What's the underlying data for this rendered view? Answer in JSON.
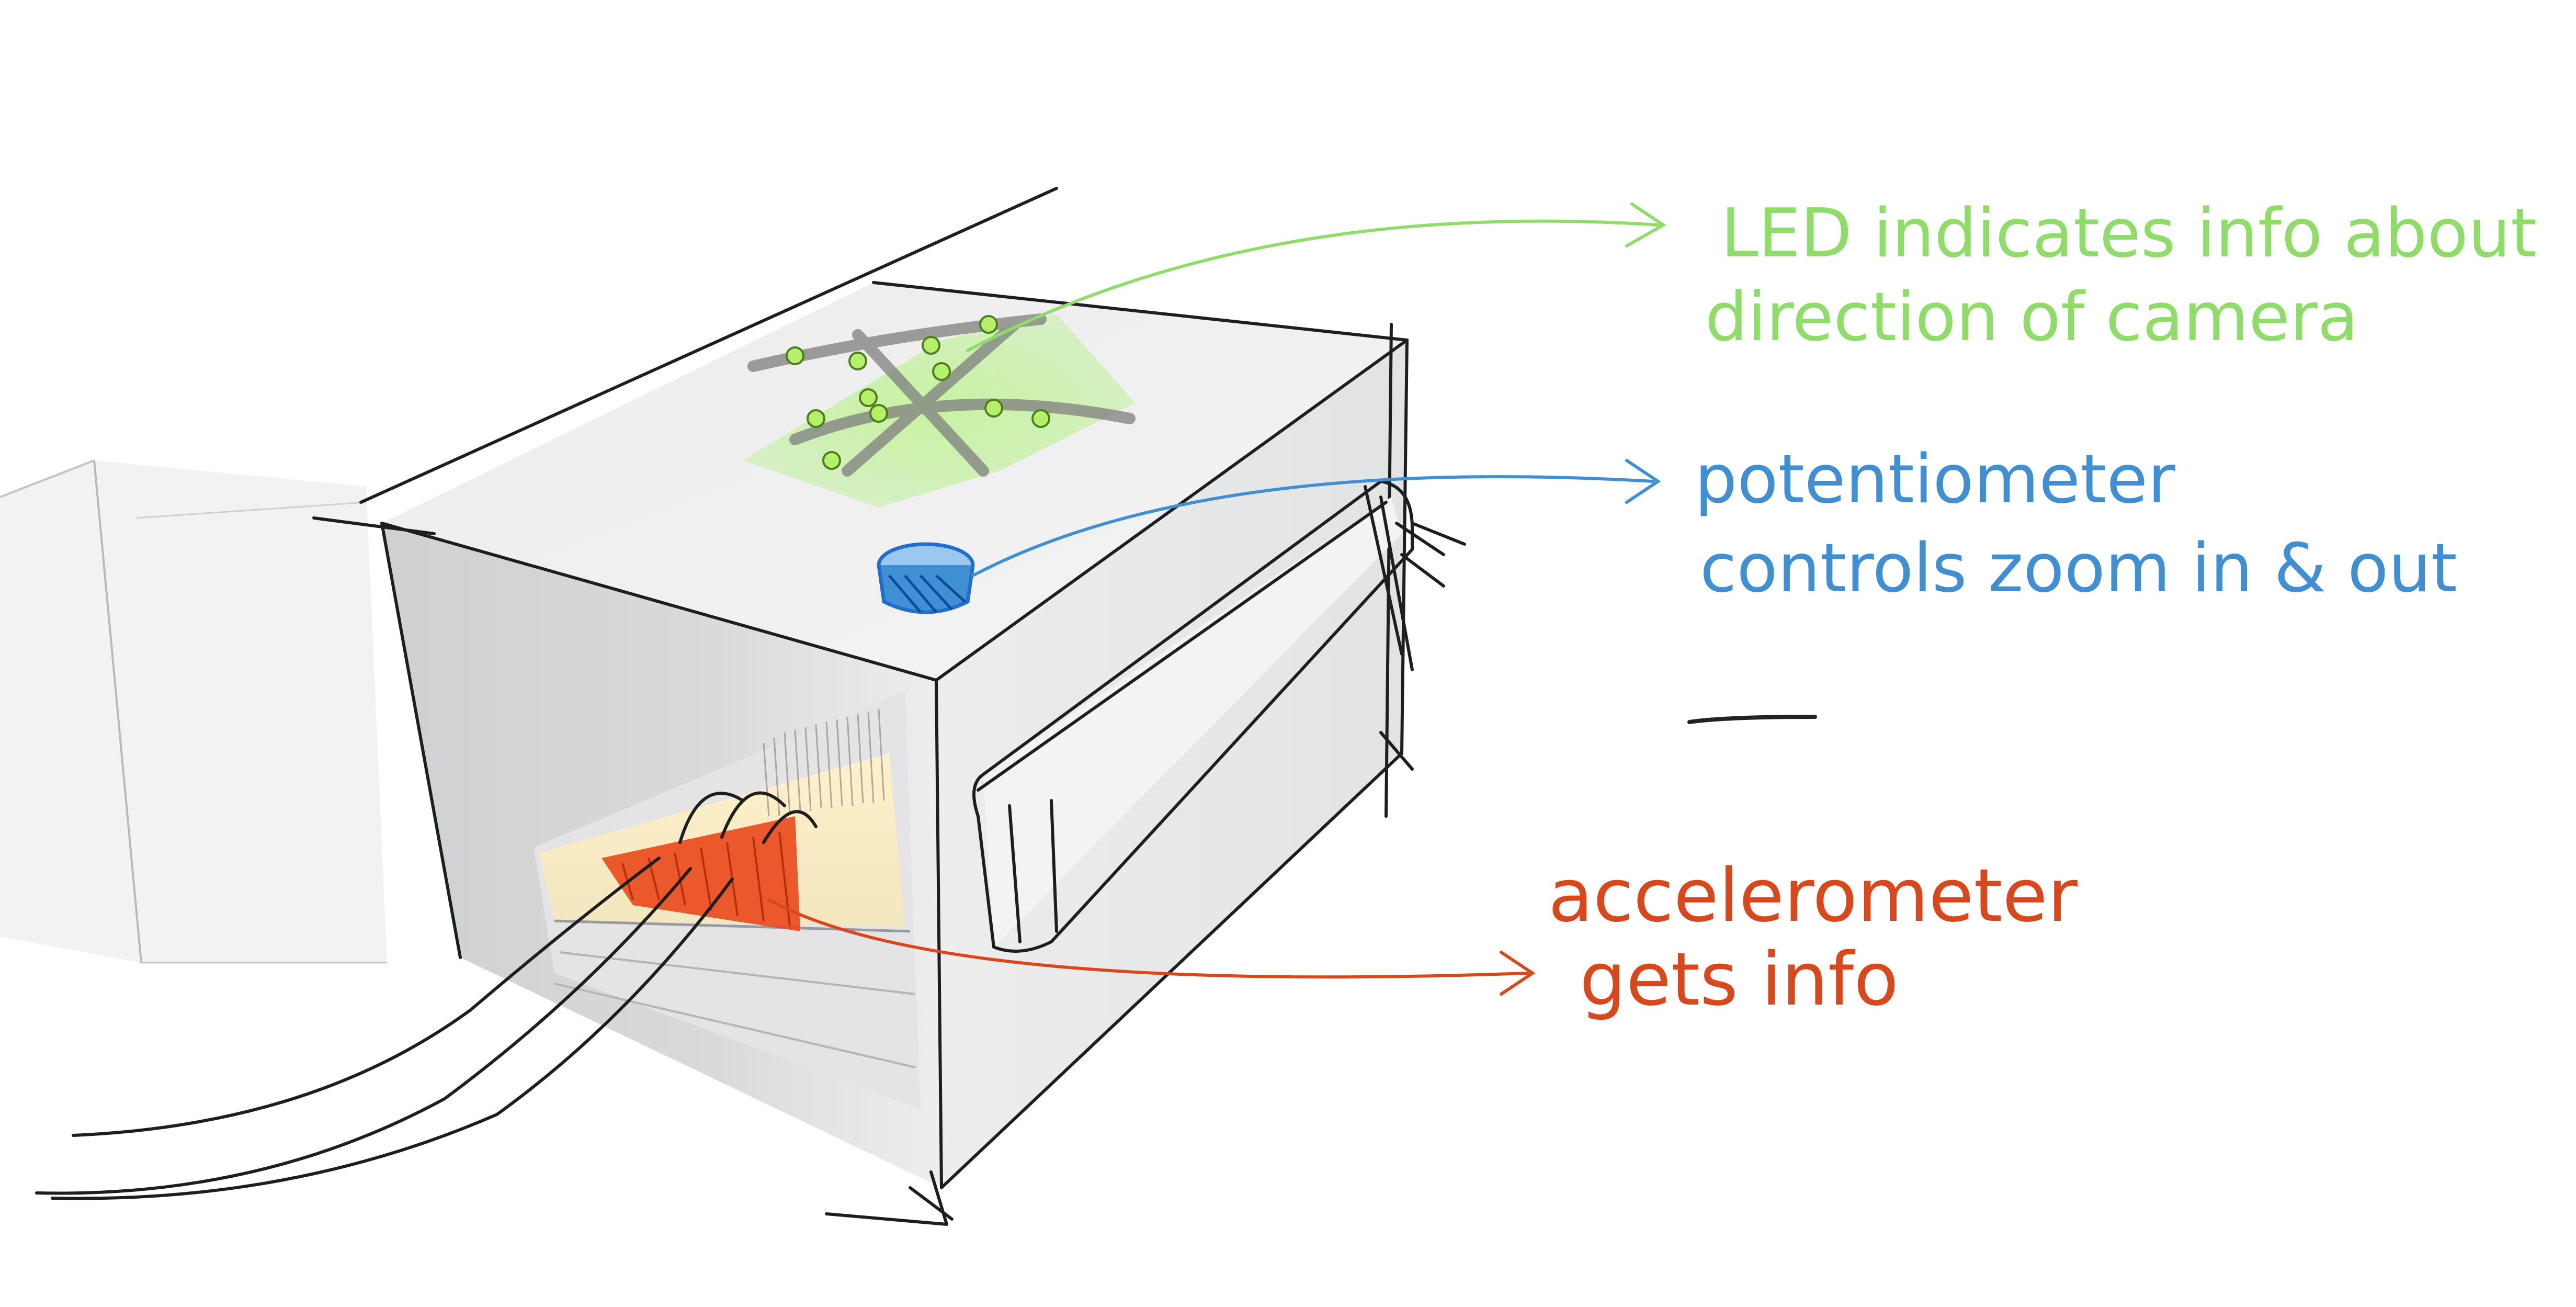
{
  "annotations": {
    "led": {
      "line1": "LED indicates info about",
      "line2": "direction of camera",
      "color": "#8fdc6a"
    },
    "potentiometer": {
      "line1": "potentiometer",
      "line2": "controls zoom in & out",
      "color": "#3f8fd2"
    },
    "accelerometer": {
      "line1": "accelerometer",
      "line2": "gets info",
      "color": "#d9481c"
    }
  }
}
